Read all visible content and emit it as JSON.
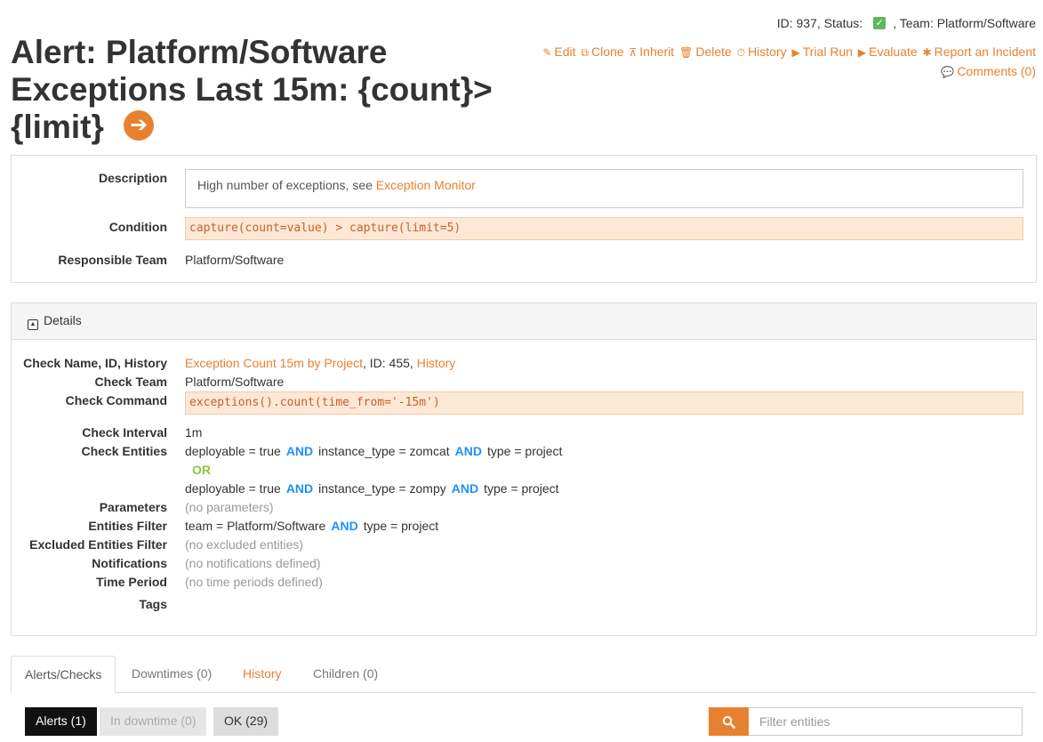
{
  "header": {
    "id_label": "ID: 937, Status:",
    "team_label": ", Team: Platform/Software",
    "title": "Alert: Platform/Software Exceptions Last 15m: {count}> {limit}"
  },
  "actions": [
    {
      "icon": "✎",
      "label": "Edit",
      "icon_name": "edit-icon"
    },
    {
      "icon": "⧉",
      "label": "Clone",
      "icon_name": "clone-icon"
    },
    {
      "icon": "⊼",
      "label": "Inherit",
      "icon_name": "sitemap-icon"
    },
    {
      "icon": "🗑",
      "label": "Delete",
      "icon_name": "trash-icon"
    },
    {
      "icon": "⏱",
      "label": "History",
      "icon_name": "clock-icon"
    },
    {
      "icon": "▶",
      "label": "Trial Run",
      "icon_name": "play-icon"
    },
    {
      "icon": "▶",
      "label": "Evaluate",
      "icon_name": "play-icon"
    },
    {
      "icon": "✱",
      "label": "Report an Incident",
      "icon_name": "bug-icon"
    },
    {
      "icon": "💬",
      "label": "Comments (0)",
      "icon_name": "comments-icon"
    }
  ],
  "summary": {
    "description_label": "Description",
    "description_text": "High number of exceptions, see ",
    "description_link": "Exception Monitor",
    "condition_label": "Condition",
    "condition_code": "capture(count=value) > capture(limit=5)",
    "team_label": "Responsible Team",
    "team_value": "Platform/Software"
  },
  "details": {
    "heading": "Details",
    "check_name_label": "Check Name, ID, History",
    "check_name_link": "Exception Count 15m by Project",
    "check_id_text": ", ID: 455, ",
    "check_history_link": "History",
    "check_team_label": "Check Team",
    "check_team_value": "Platform/Software",
    "check_command_label": "Check Command",
    "check_command_code": "exceptions().count(time_from='-15m')",
    "interval_label": "Check Interval",
    "interval_value": "1m",
    "entities_label": "Check Entities",
    "entity_group_1": {
      "a": "deployable = true",
      "b": "instance_type = zomcat",
      "c": "type = project"
    },
    "or_label": "OR",
    "and_label": "AND",
    "entity_group_2": {
      "a": "deployable = true",
      "b": "instance_type = zompy",
      "c": "type = project"
    },
    "parameters_label": "Parameters",
    "parameters_value": "(no parameters)",
    "entities_filter_label": "Entities Filter",
    "entities_filter": {
      "a": "team = Platform/Software",
      "b": "type = project"
    },
    "excluded_label": "Excluded Entities Filter",
    "excluded_value": "(no excluded entities)",
    "notifications_label": "Notifications",
    "notifications_value": "(no notifications defined)",
    "time_period_label": "Time Period",
    "time_period_value": "(no time periods defined)",
    "tags_label": "Tags"
  },
  "tabs": [
    {
      "label": "Alerts/Checks"
    },
    {
      "label": "Downtimes (0)"
    },
    {
      "label": "History"
    },
    {
      "label": "Children (0)"
    }
  ],
  "filters": {
    "alerts": "Alerts (1)",
    "downtime": "In downtime (0)",
    "ok": "OK (29)"
  },
  "search": {
    "placeholder": "Filter entities"
  },
  "colors": {
    "accent": "#e8812f",
    "and_keyword": "#1e90ff",
    "or_keyword": "#8cc63f",
    "status_ok": "#5cb85c"
  }
}
